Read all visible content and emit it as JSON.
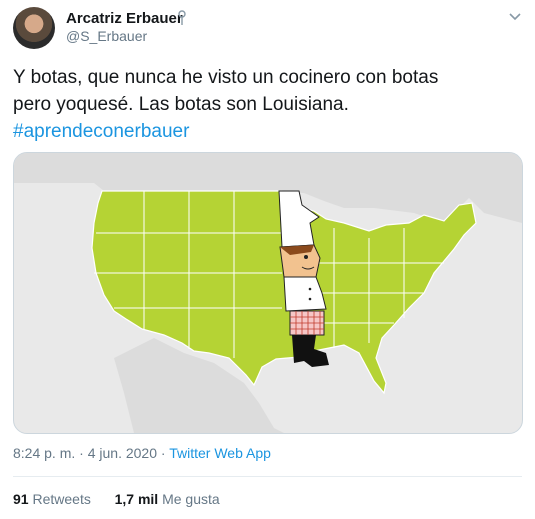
{
  "author": {
    "name": "Arcatriz Erbauer",
    "handle": "@S_Erbauer",
    "avatar_icon": "profile-photo",
    "pinned_icon": "pushpin-icon"
  },
  "tweet": {
    "line1": "Y botas, que nunca he visto un cocinero con botas",
    "line2": "pero yoquesé. Las botas son Louisiana.",
    "hashtag": "#aprendeconerbauer"
  },
  "media": {
    "description_icon": "us-map-cook-figure",
    "land_color": "#b5d334",
    "water_color": "#e9e9e9"
  },
  "meta": {
    "time": "8:24 p. m.",
    "sep1": " · ",
    "date": "4 jun. 2020",
    "sep2": " · ",
    "app": "Twitter Web App"
  },
  "stats": {
    "retweets_count": "91",
    "retweets_label": "Retweets",
    "likes_count": "1,7 mil",
    "likes_label": "Me gusta"
  },
  "colors": {
    "link": "#1b95e0",
    "secondary_text": "#657786"
  }
}
